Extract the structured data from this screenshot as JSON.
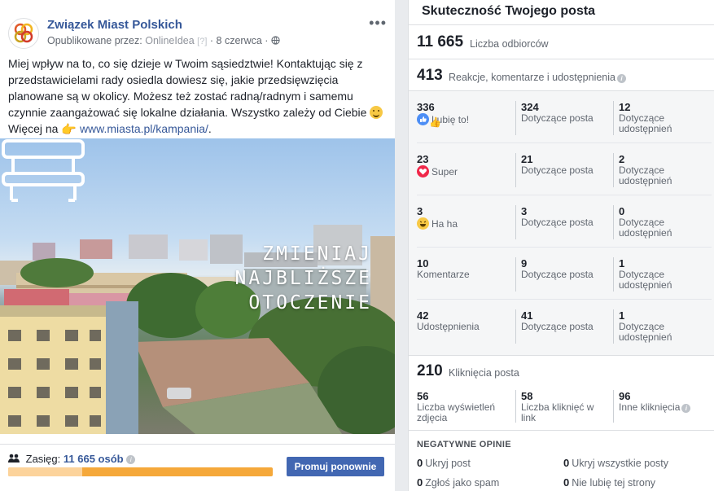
{
  "post": {
    "page_name": "Związek Miast Polskich",
    "published_by_label": "Opublikowane przez:",
    "publisher": "OnlineIdea",
    "publisher_hint": "[?]",
    "date": "· 8 czerwca ·",
    "text_main": "Miej wpływ na to, co się dzieje w Twoim sąsiedztwie! Kontaktując się z przedstawicielami rady osiedla dowiesz się, jakie przedsięwzięcia planowane są w okolicy. Możesz też zostać radną/radnym i samemu czynnie zaangażować się lokalne działania. Wszystko zależy od Ciebie",
    "more_text": "Więcej na",
    "link": "www.miasta.pl/kampania/",
    "link_suffix": ".",
    "image_overlay": [
      "ZMIENIAJ",
      "NAJBLIŻSZE",
      "OTOCZENIE"
    ],
    "reach_label": "Zasięg:",
    "reach_value": "11 665 osób",
    "reach_progress_fraction": 0.28,
    "promote_button": "Promuj ponownie"
  },
  "insights": {
    "title": "Skuteczność Twojego posta",
    "recipients": {
      "value": "11 665",
      "label": "Liczba odbiorców"
    },
    "engagement": {
      "value": "413",
      "label": "Reakcje, komentarze i udostępnienia"
    },
    "reactions": [
      {
        "total": "336",
        "label": "Lubię to!",
        "icon": "like-icon",
        "on_post": "324",
        "on_post_label": "Dotyczące posta",
        "on_shares": "12",
        "on_shares_label": "Dotyczące udostępnień"
      },
      {
        "total": "23",
        "label": "Super",
        "icon": "love-icon",
        "on_post": "21",
        "on_post_label": "Dotyczące posta",
        "on_shares": "2",
        "on_shares_label": "Dotyczące udostępnień"
      },
      {
        "total": "3",
        "label": "Ha ha",
        "icon": "haha-icon",
        "on_post": "3",
        "on_post_label": "Dotyczące posta",
        "on_shares": "0",
        "on_shares_label": "Dotyczące udostępnień"
      },
      {
        "total": "10",
        "label": "Komentarze",
        "icon": "",
        "on_post": "9",
        "on_post_label": "Dotyczące posta",
        "on_shares": "1",
        "on_shares_label": "Dotyczące udostępnień"
      },
      {
        "total": "42",
        "label": "Udostępnienia",
        "icon": "",
        "on_post": "41",
        "on_post_label": "Dotyczące posta",
        "on_shares": "1",
        "on_shares_label": "Dotyczące udostępnień"
      }
    ],
    "clicks": {
      "value": "210",
      "label": "Kliknięcia posta",
      "items": [
        {
          "value": "56",
          "label": "Liczba wyświetleń zdjęcia"
        },
        {
          "value": "58",
          "label": "Liczba kliknięć w link"
        },
        {
          "value": "96",
          "label": "Inne kliknięcia"
        }
      ]
    },
    "negative": {
      "title": "NEGATYWNE OPINIE",
      "items": [
        {
          "value": "0",
          "label": "Ukryj post"
        },
        {
          "value": "0",
          "label": "Ukryj wszystkie posty"
        },
        {
          "value": "0",
          "label": "Zgłoś jako spam"
        },
        {
          "value": "0",
          "label": "Nie lubię tej strony"
        }
      ]
    }
  },
  "colors": {
    "link": "#365899",
    "accent_button": "#4267b2",
    "progress": "#f5a83a"
  }
}
